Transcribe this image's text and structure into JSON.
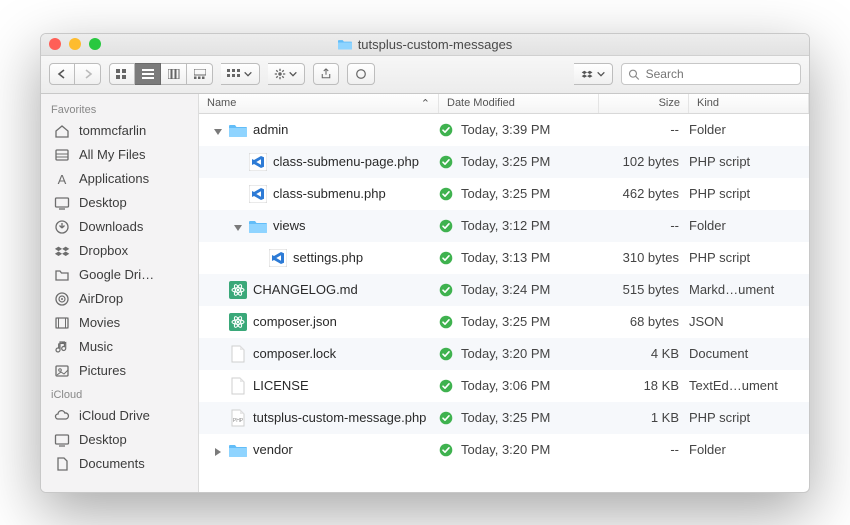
{
  "window": {
    "title": "tutsplus-custom-messages",
    "search_placeholder": "Search"
  },
  "columns": {
    "name": "Name",
    "date": "Date Modified",
    "size": "Size",
    "kind": "Kind"
  },
  "sidebar": {
    "sections": [
      {
        "heading": "Favorites",
        "items": [
          {
            "icon": "home",
            "label": "tommcfarlin"
          },
          {
            "icon": "all-files",
            "label": "All My Files"
          },
          {
            "icon": "applications",
            "label": "Applications"
          },
          {
            "icon": "desktop",
            "label": "Desktop"
          },
          {
            "icon": "downloads",
            "label": "Downloads"
          },
          {
            "icon": "dropbox",
            "label": "Dropbox"
          },
          {
            "icon": "folder",
            "label": "Google Dri…"
          },
          {
            "icon": "airdrop",
            "label": "AirDrop"
          },
          {
            "icon": "movies",
            "label": "Movies"
          },
          {
            "icon": "music",
            "label": "Music"
          },
          {
            "icon": "pictures",
            "label": "Pictures"
          }
        ]
      },
      {
        "heading": "iCloud",
        "items": [
          {
            "icon": "icloud",
            "label": "iCloud Drive"
          },
          {
            "icon": "desktop",
            "label": "Desktop"
          },
          {
            "icon": "documents",
            "label": "Documents"
          }
        ]
      }
    ]
  },
  "files": [
    {
      "indent": 0,
      "expand": "open",
      "icon": "folder",
      "name": "admin",
      "synced": true,
      "date": "Today, 3:39 PM",
      "size": "--",
      "kind": "Folder"
    },
    {
      "indent": 1,
      "expand": "none",
      "icon": "vscode",
      "name": "class-submenu-page.php",
      "synced": true,
      "date": "Today, 3:25 PM",
      "size": "102 bytes",
      "kind": "PHP script"
    },
    {
      "indent": 1,
      "expand": "none",
      "icon": "vscode",
      "name": "class-submenu.php",
      "synced": true,
      "date": "Today, 3:25 PM",
      "size": "462 bytes",
      "kind": "PHP script"
    },
    {
      "indent": 1,
      "expand": "open",
      "icon": "folder",
      "name": "views",
      "synced": true,
      "date": "Today, 3:12 PM",
      "size": "--",
      "kind": "Folder"
    },
    {
      "indent": 2,
      "expand": "none",
      "icon": "vscode",
      "name": "settings.php",
      "synced": true,
      "date": "Today, 3:13 PM",
      "size": "310 bytes",
      "kind": "PHP script"
    },
    {
      "indent": 0,
      "expand": "none",
      "icon": "atom",
      "name": "CHANGELOG.md",
      "synced": true,
      "date": "Today, 3:24 PM",
      "size": "515 bytes",
      "kind": "Markd…ument"
    },
    {
      "indent": 0,
      "expand": "none",
      "icon": "atom",
      "name": "composer.json",
      "synced": true,
      "date": "Today, 3:25 PM",
      "size": "68 bytes",
      "kind": "JSON"
    },
    {
      "indent": 0,
      "expand": "none",
      "icon": "blank",
      "name": "composer.lock",
      "synced": true,
      "date": "Today, 3:20 PM",
      "size": "4 KB",
      "kind": "Document"
    },
    {
      "indent": 0,
      "expand": "none",
      "icon": "blank",
      "name": "LICENSE",
      "synced": true,
      "date": "Today, 3:06 PM",
      "size": "18 KB",
      "kind": "TextEd…ument"
    },
    {
      "indent": 0,
      "expand": "none",
      "icon": "php",
      "name": "tutsplus-custom-message.php",
      "synced": true,
      "date": "Today, 3:25 PM",
      "size": "1 KB",
      "kind": "PHP script"
    },
    {
      "indent": 0,
      "expand": "closed",
      "icon": "folder",
      "name": "vendor",
      "synced": true,
      "date": "Today, 3:20 PM",
      "size": "--",
      "kind": "Folder"
    }
  ]
}
